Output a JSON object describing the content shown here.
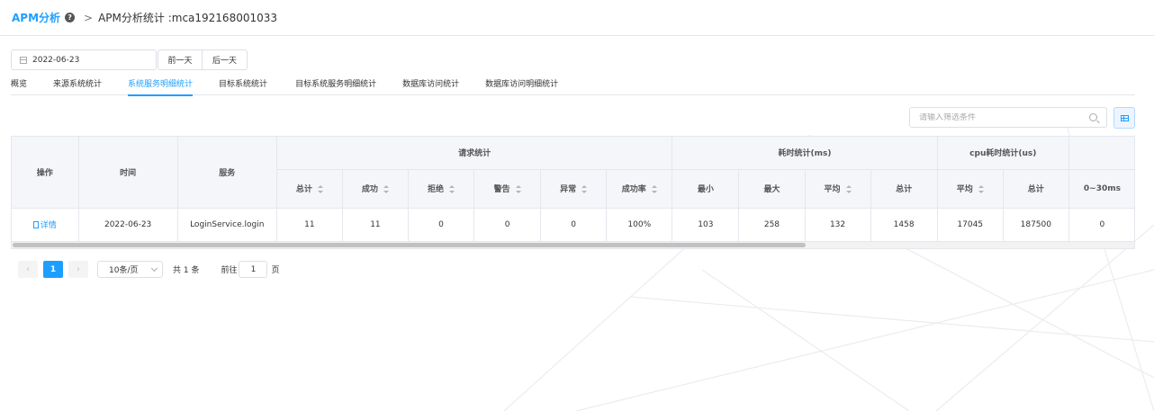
{
  "header": {
    "brand": "APM分析",
    "help": "?",
    "separator": ">",
    "title": "APM分析统计 :mca192168001033"
  },
  "date_bar": {
    "date": "2022-06-23",
    "prev_label": "前一天",
    "next_label": "后一天"
  },
  "tabs": [
    {
      "label": "概览",
      "active": false
    },
    {
      "label": "来源系统统计",
      "active": false
    },
    {
      "label": "系统服务明细统计",
      "active": true
    },
    {
      "label": "目标系统统计",
      "active": false
    },
    {
      "label": "目标系统服务明细统计",
      "active": false
    },
    {
      "label": "数据库访问统计",
      "active": false
    },
    {
      "label": "数据库访问明细统计",
      "active": false
    }
  ],
  "filter": {
    "placeholder": "请输入筛选条件"
  },
  "table": {
    "headers": {
      "action": "操作",
      "time": "时间",
      "service": "服务",
      "request_group": "请求统计",
      "duration_group": "耗时统计(ms)",
      "cpu_group": "cpu耗时统计(us)",
      "request_cols": [
        "总计",
        "成功",
        "拒绝",
        "警告",
        "异常",
        "成功率"
      ],
      "duration_cols": [
        "最小",
        "最大",
        "平均",
        "总计"
      ],
      "cpu_cols": [
        "平均",
        "总计"
      ],
      "extra_col": "0~30ms"
    },
    "rows": [
      {
        "action": "详情",
        "time": "2022-06-23",
        "service": "LoginService.login",
        "total": "11",
        "success": "11",
        "reject": "0",
        "warn": "0",
        "error": "0",
        "success_rate": "100%",
        "min": "103",
        "max": "258",
        "avg": "132",
        "sum": "1458",
        "cpu_avg": "17045",
        "cpu_sum": "187500",
        "range_0_30": "0"
      }
    ]
  },
  "pagination": {
    "prev": "‹",
    "current": "1",
    "next": "›",
    "page_size": "10条/页",
    "total": "共 1 条",
    "goto_label": "前往",
    "goto_value": "1",
    "goto_unit": "页"
  }
}
